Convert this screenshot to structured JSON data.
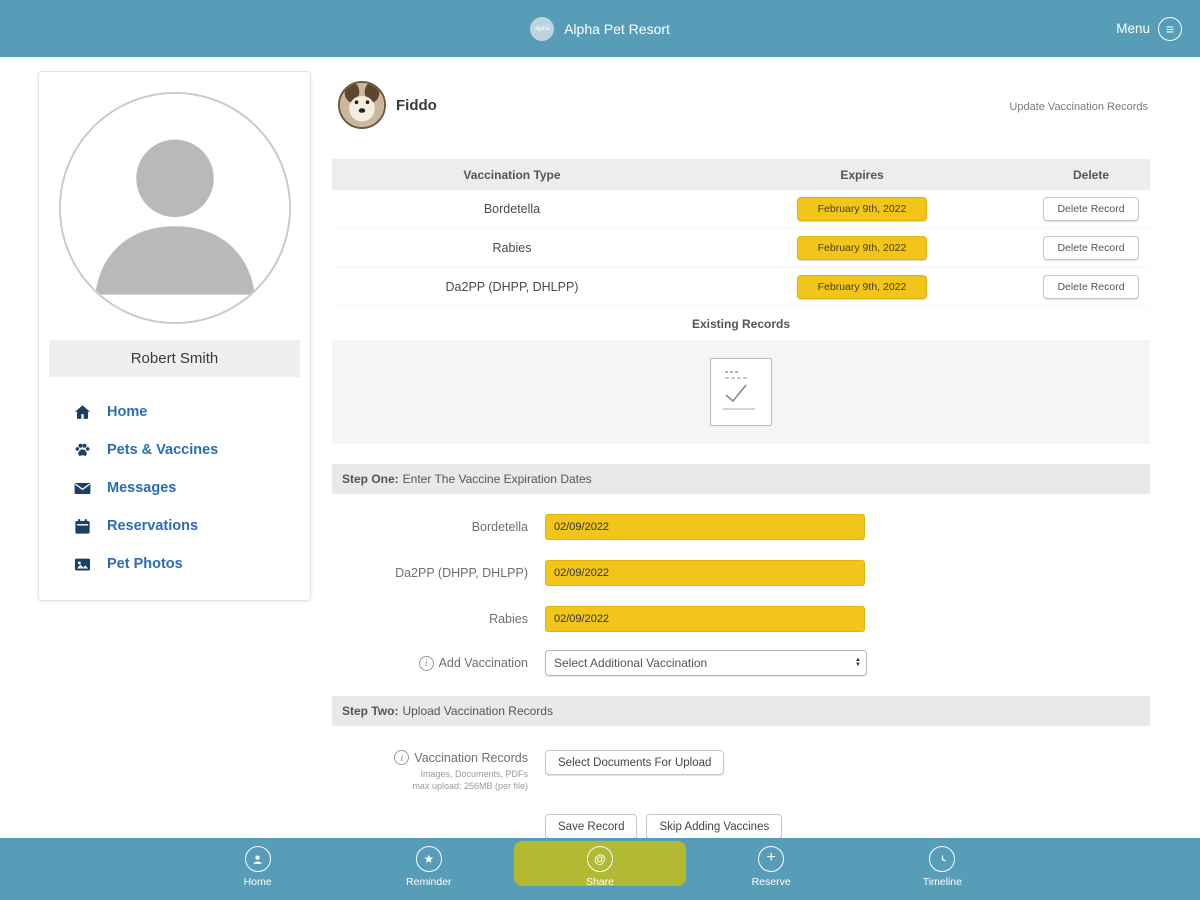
{
  "header": {
    "logo_text": "alpha",
    "title": "Alpha Pet Resort",
    "menu_label": "Menu"
  },
  "sidebar": {
    "user_name": "Robert Smith",
    "items": [
      {
        "label": "Home"
      },
      {
        "label": "Pets & Vaccines"
      },
      {
        "label": "Messages"
      },
      {
        "label": "Reservations"
      },
      {
        "label": "Pet Photos"
      }
    ]
  },
  "main": {
    "pet_name": "Fiddo",
    "update_link": "Update Vaccination Records",
    "table": {
      "headers": [
        "Vaccination Type",
        "Expires",
        "Delete"
      ],
      "rows": [
        {
          "type": "Bordetella",
          "expires": "February 9th, 2022",
          "delete_label": "Delete Record"
        },
        {
          "type": "Rabies",
          "expires": "February 9th, 2022",
          "delete_label": "Delete Record"
        },
        {
          "type": "Da2PP (DHPP, DHLPP)",
          "expires": "February 9th, 2022",
          "delete_label": "Delete Record"
        }
      ],
      "existing_records_label": "Existing Records"
    },
    "step_one": {
      "prefix": "Step One:",
      "title": "Enter The Vaccine Expiration Dates",
      "fields": [
        {
          "label": "Bordetella",
          "value": "02/09/2022"
        },
        {
          "label": "Da2PP (DHPP, DHLPP)",
          "value": "02/09/2022"
        },
        {
          "label": "Rabies",
          "value": "02/09/2022"
        }
      ],
      "add_label": "Add Vaccination",
      "select_value": "Select Additional Vaccination"
    },
    "step_two": {
      "prefix": "Step Two:",
      "title": "Upload Vaccination Records",
      "records_label": "Vaccination Records",
      "hint_line1": "Images, Documents, PDFs",
      "hint_line2": "max upload: 256MB (per file)",
      "upload_button": "Select Documents For Upload"
    },
    "actions": {
      "save": "Save Record",
      "skip": "Skip Adding Vaccines"
    }
  },
  "bottom_nav": {
    "items": [
      {
        "label": "Home",
        "active": false
      },
      {
        "label": "Reminder",
        "active": false
      },
      {
        "label": "Share",
        "active": true
      },
      {
        "label": "Reserve",
        "active": false
      },
      {
        "label": "Timeline",
        "active": false
      }
    ]
  },
  "colors": {
    "top_bar": "#579db7",
    "accent_yellow": "#f2c51b",
    "active_nav_pill": "#b2b933",
    "nav_link_blue": "#2a6db6"
  }
}
